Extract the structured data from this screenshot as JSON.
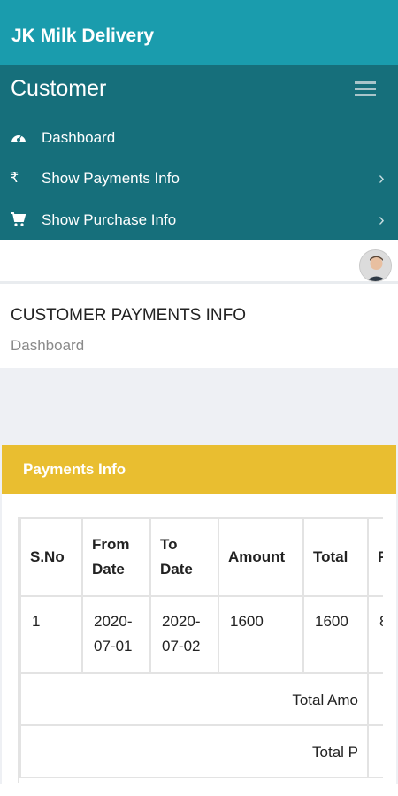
{
  "app": {
    "title": "JK Milk Delivery"
  },
  "sidebar": {
    "title": "Customer",
    "items": [
      {
        "icon": "speedometer-icon",
        "label": "Dashboard",
        "has_chevron": false
      },
      {
        "icon": "rupee-icon",
        "label": "Show Payments Info",
        "has_chevron": true
      },
      {
        "icon": "cart-icon",
        "label": "Show Purchase Info",
        "has_chevron": true
      }
    ]
  },
  "page": {
    "title": "CUSTOMER PAYMENTS INFO",
    "breadcrumb": "Dashboard"
  },
  "card": {
    "title": "Payments Info",
    "table": {
      "headers": [
        "S.No",
        "From Date",
        "To Date",
        "Amount",
        "Total",
        "P"
      ],
      "rows": [
        [
          "1",
          "2020-07-01",
          "2020-07-02",
          "1600",
          "1600",
          "8"
        ]
      ],
      "summary": [
        "Total Amo",
        "Total P"
      ]
    }
  },
  "colors": {
    "header": "#1a9cad",
    "sidebar": "#166f7b",
    "card_header": "#e9be30",
    "content_bg": "#eef0f4"
  }
}
